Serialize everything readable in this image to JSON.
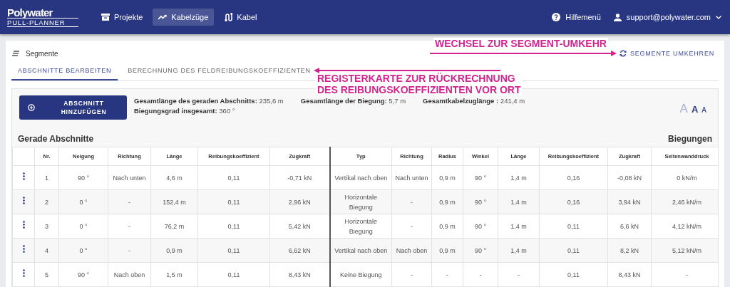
{
  "nav": {
    "logo": {
      "brand": "Polywater",
      "product": "PULL-PLANNER"
    },
    "items": [
      {
        "label": "Projekte",
        "kind": "archive",
        "selected": false
      },
      {
        "label": "Kabelzüge",
        "kind": "trend",
        "selected": true
      },
      {
        "label": "Kabel",
        "kind": "cable",
        "selected": false
      }
    ],
    "help": "Hilfemenü",
    "user": "support@polywater.com"
  },
  "section_title": "Segmente",
  "reverse_button": "SEGMENTE UMKEHREN",
  "tabs": [
    {
      "label": "ABSCHNITTE BEARBEITEN",
      "selected": true
    },
    {
      "label": "BERECHNUNG DES FELDREIBUNGSKOEFFIZIENTEN",
      "selected": false
    }
  ],
  "add_button": "ABSCHNITT HINZUFÜGEN",
  "stats": [
    {
      "label": "Gesamtlänge des geraden Abschnitts:",
      "value": "235,6 m"
    },
    {
      "label": "Gesamtlänge der Biegung:",
      "value": "5,7 m"
    },
    {
      "label": "Gesamtkabelzuglänge :",
      "value": "241,4 m"
    },
    {
      "label": "Biegungsgrad insgesamt:",
      "value": "360 °"
    }
  ],
  "font_size_buttons": [
    {
      "label": "A",
      "kind": "large",
      "disabled": true
    },
    {
      "label": "A",
      "kind": "medium",
      "disabled": false
    },
    {
      "label": "A",
      "kind": "small",
      "disabled": false
    }
  ],
  "straight_title": "Gerade Abschnitte",
  "bends_title": "Biegungen",
  "table": {
    "columns": [
      "Nr.",
      "Neigung",
      "Richtung",
      "Länge",
      "Reibungskoeffizient",
      "Zugkraft",
      "Typ",
      "Richtung",
      "Radius",
      "Winkel",
      "Länge",
      "Reibungskoeffizient",
      "Zugkraft",
      "Seitenwanddruck"
    ],
    "rows": [
      [
        "1",
        "90 °",
        "Nach unten",
        "4,6 m",
        "0,11",
        "-0,71 kN",
        "Vertikal nach oben",
        "Nach unten",
        "0,9 m",
        "90 °",
        "1,4 m",
        "0,16",
        "-0,08 kN",
        "0 kN/m"
      ],
      [
        "2",
        "0 °",
        "-",
        "152,4 m",
        "0,11",
        "2,96 kN",
        "Horizontale Biegung",
        "-",
        "0,9 m",
        "90 °",
        "1,4 m",
        "0,16",
        "3,94 kN",
        "2,46 kN/m"
      ],
      [
        "3",
        "0 °",
        "-",
        "76,2 m",
        "0,11",
        "5,42 kN",
        "Horizontale Biegung",
        "-",
        "0,9 m",
        "90 °",
        "1,4 m",
        "0,11",
        "6,6 kN",
        "4,12 kN/m"
      ],
      [
        "4",
        "0 °",
        "-",
        "0,9 m",
        "0,11",
        "6,62 kN",
        "Vertikal nach oben",
        "Nach oben",
        "0,9 m",
        "90 °",
        "1,4 m",
        "0,11",
        "8,2 kN",
        "5,12 kN/m"
      ],
      [
        "5",
        "90 °",
        "Nach oben",
        "1,5 m",
        "0,11",
        "8,43 kN",
        "Keine Biegung",
        "-",
        "-",
        "-",
        "-",
        "0,11",
        "8,43 kN",
        "-"
      ]
    ]
  },
  "annotations": [
    {
      "kind": "reverse",
      "lines": [
        "WECHSEL ZUR SEGMENT-UMKEHR"
      ]
    },
    {
      "kind": "tab",
      "lines": [
        "REGISTERKARTE ZUR RÜCKRECHNUNG",
        "DES REIBUNGSKOEFFIZIENTEN VOR ORT"
      ]
    }
  ]
}
